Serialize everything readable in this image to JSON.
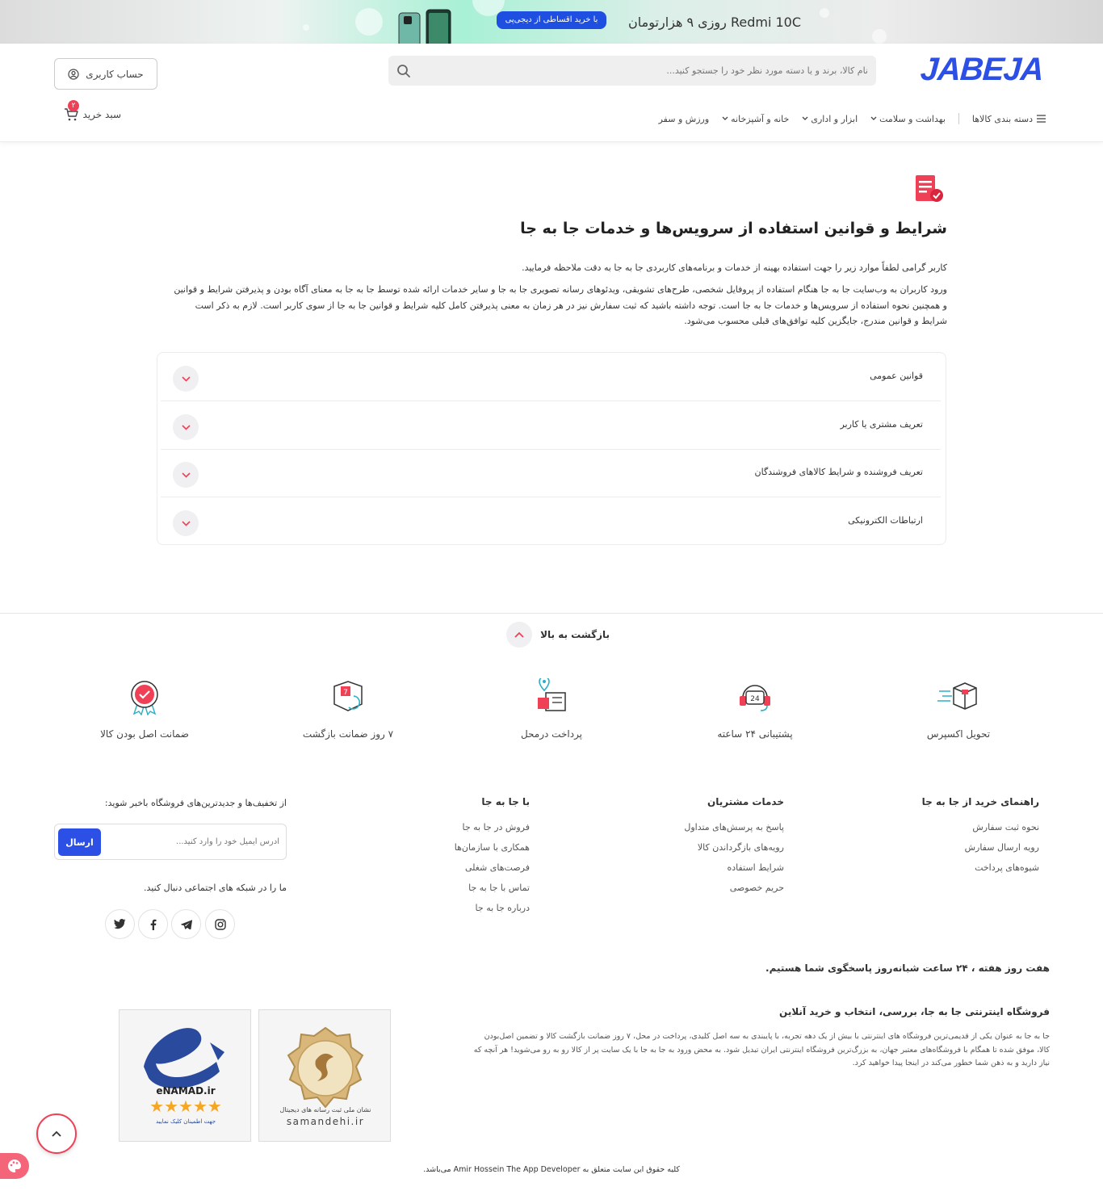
{
  "banner": {
    "headline": "Redmi 10C روزی ۹ هزارتومان",
    "pill": "با خرید اقساطی از دیجی‌پی"
  },
  "header": {
    "logo": "JABEJA",
    "search_placeholder": "نام کالا، برند و یا دسته مورد نظر خود را جستجو کنید...",
    "account_label": "حساب کاربری",
    "cart_label": "سبد خرید",
    "cart_count": "۲",
    "categories_label": "دسته بندی کالاها",
    "nav": [
      "بهداشت و سلامت",
      "ابزار و اداری",
      "خانه و آشپزخانه",
      "ورزش و سفر"
    ]
  },
  "main": {
    "title": "شرایط و قوانین استفاده از سرویس‌ها و خدمات جا به جا",
    "intro1": "کاربر گرامی لطفاً موارد زیر را جهت استفاده بهینه از خدمات و برنامه‌های کاربردی جا به جا به دقت ملاحظه فرمایید.",
    "intro2": "ورود کاربران به وب‌سایت جا به جا هنگام استفاده از پروفایل شخصی، طرح‌های تشویقی، ویدئوهای رسانه تصویری جا به جا و سایر خدمات ارائه شده توسط جا به جا به معنای آگاه بودن و پذیرفتن شرایط و قوانین و همچنین نحوه استفاده از سرویس‌ها و خدمات جا به جا است. توجه داشته باشید که ثبت سفارش نیز در هر زمان به معنی پذیرفتن کامل کلیه شرایط و قوانین جا به جا از سوی کاربر است. لازم به ذکر است شرایط و قوانین مندرج، جایگزین کلیه توافق‌های قبلی محسوب می‌شود.",
    "accordion": [
      "قوانین عمومی",
      "تعریف مشتری یا کاربر",
      "تعریف فروشنده و شرایط کالاهای فروشندگان",
      "ارتباطات الکترونیکی"
    ]
  },
  "back_to_top": "بازگشت به بالا",
  "features": [
    "تحویل اکسپرس",
    "پشتیبانی ۲۴ ساعته",
    "پرداخت درمحل",
    "۷ روز ضمانت بازگشت",
    "ضمانت اصل بودن کالا"
  ],
  "footer": {
    "col1": {
      "title": "راهنمای خرید از جا به جا",
      "links": [
        "نحوه ثبت سفارش",
        "رویه ارسال سفارش",
        "شیوه‌های پرداخت"
      ]
    },
    "col2": {
      "title": "خدمات مشتریان",
      "links": [
        "پاسخ به پرسش‌های متداول",
        "رویه‌های بازگرداندن کالا",
        "شرایط استفاده",
        "حریم خصوصی"
      ]
    },
    "col3": {
      "title": "با جا به جا",
      "links": [
        "فروش در جا به جا",
        "همکاری با سازمان‌ها",
        "فرصت‌های شغلی",
        "تماس با جا به جا",
        "درباره جا به جا"
      ]
    },
    "newsletter_title": "از تخفیف‌ها و جدیدترین‌های فروشگاه باخبر شوید:",
    "newsletter_placeholder": "آدرس ایمیل خود را وارد کنید...",
    "newsletter_button": "ارسال",
    "social_title": "ما را در شبکه های اجتماعی دنبال کنید.",
    "support_text": "هفت روز هفته ، ۲۴ ساعت شبانه‌روز پاسخگوی شما هستیم.",
    "about_title": "فروشگاه اینترنتی جا به جا، بررسی، انتخاب و خرید آنلاین",
    "about_text": "جا به جا به عنوان یکی از قدیمی‌ترین فروشگاه های اینترنتی با بیش از یک دهه تجربه، با پایبندی به سه اصل کلیدی، پرداخت در محل، ۷ روز ضمانت بازگشت کالا و تضمین اصل‌بودن کالا، موفق شده تا همگام با فروشگاه‌های معتبر جهان، به بزرگ‌ترین فروشگاه اینترنتی ایران تبدیل شود. به محض ورود به جا به جا با یک سایت پر از کالا رو به رو می‌شوید! هر آنچه که نیاز دارید و به ذهن شما خطور می‌کند در اینجا پیدا خواهید کرد.",
    "trust1": "samandehi.ir",
    "trust1_caption": "نشان ملی ثبت رسانه های دیجیتال",
    "trust2": "eNAMAD.ir",
    "trust2_caption": "جهت اطمینان کلیک نمایید",
    "copyright": "کلیه حقوق این سایت متعلق به Amir Hossein The App Developer می‌باشد."
  },
  "colors": {
    "brand": "#2c4fe5",
    "accent": "#ef4056"
  },
  "icons": [
    "search-icon",
    "user-icon",
    "cart-icon",
    "menu-icon",
    "chevron-down-icon",
    "chevron-up-icon",
    "document-check-icon",
    "truck-icon",
    "support-24-icon",
    "cash-on-delivery-icon",
    "return-7-days-icon",
    "badge-original-icon",
    "twitter-icon",
    "facebook-icon",
    "telegram-icon",
    "instagram-icon",
    "palette-icon"
  ]
}
